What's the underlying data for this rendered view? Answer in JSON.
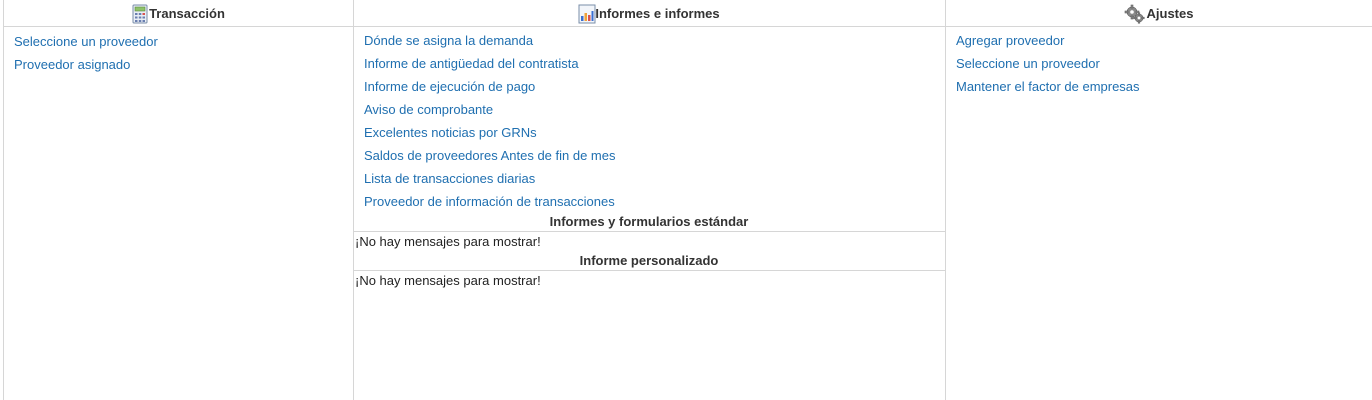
{
  "transaction": {
    "title": "Transacción",
    "icon": "calculator-icon",
    "links": [
      "Seleccione un proveedor",
      "Proveedor asignado"
    ]
  },
  "reports": {
    "title": "Informes e informes",
    "icon": "bar-chart-icon",
    "links": [
      "Dónde se asigna la demanda",
      "Informe de antigüedad del contratista",
      "Informe de ejecución de pago",
      "Aviso de comprobante",
      "Excelentes noticias por GRNs",
      "Saldos de proveedores Antes de fin de mes",
      "Lista de transacciones diarias",
      "Proveedor de información de transacciones"
    ],
    "standard": {
      "title": "Informes y formularios estándar",
      "empty": "¡No hay mensajes para mostrar!"
    },
    "custom": {
      "title": "Informe personalizado",
      "empty": "¡No hay mensajes para mostrar!"
    }
  },
  "settings": {
    "title": "Ajustes",
    "icon": "gears-icon",
    "links": [
      "Agregar proveedor",
      "Seleccione un proveedor",
      "Mantener el factor de empresas"
    ]
  },
  "colors": {
    "link": "#1f6fb0",
    "border": "#d6d6d6",
    "text": "#333333"
  }
}
